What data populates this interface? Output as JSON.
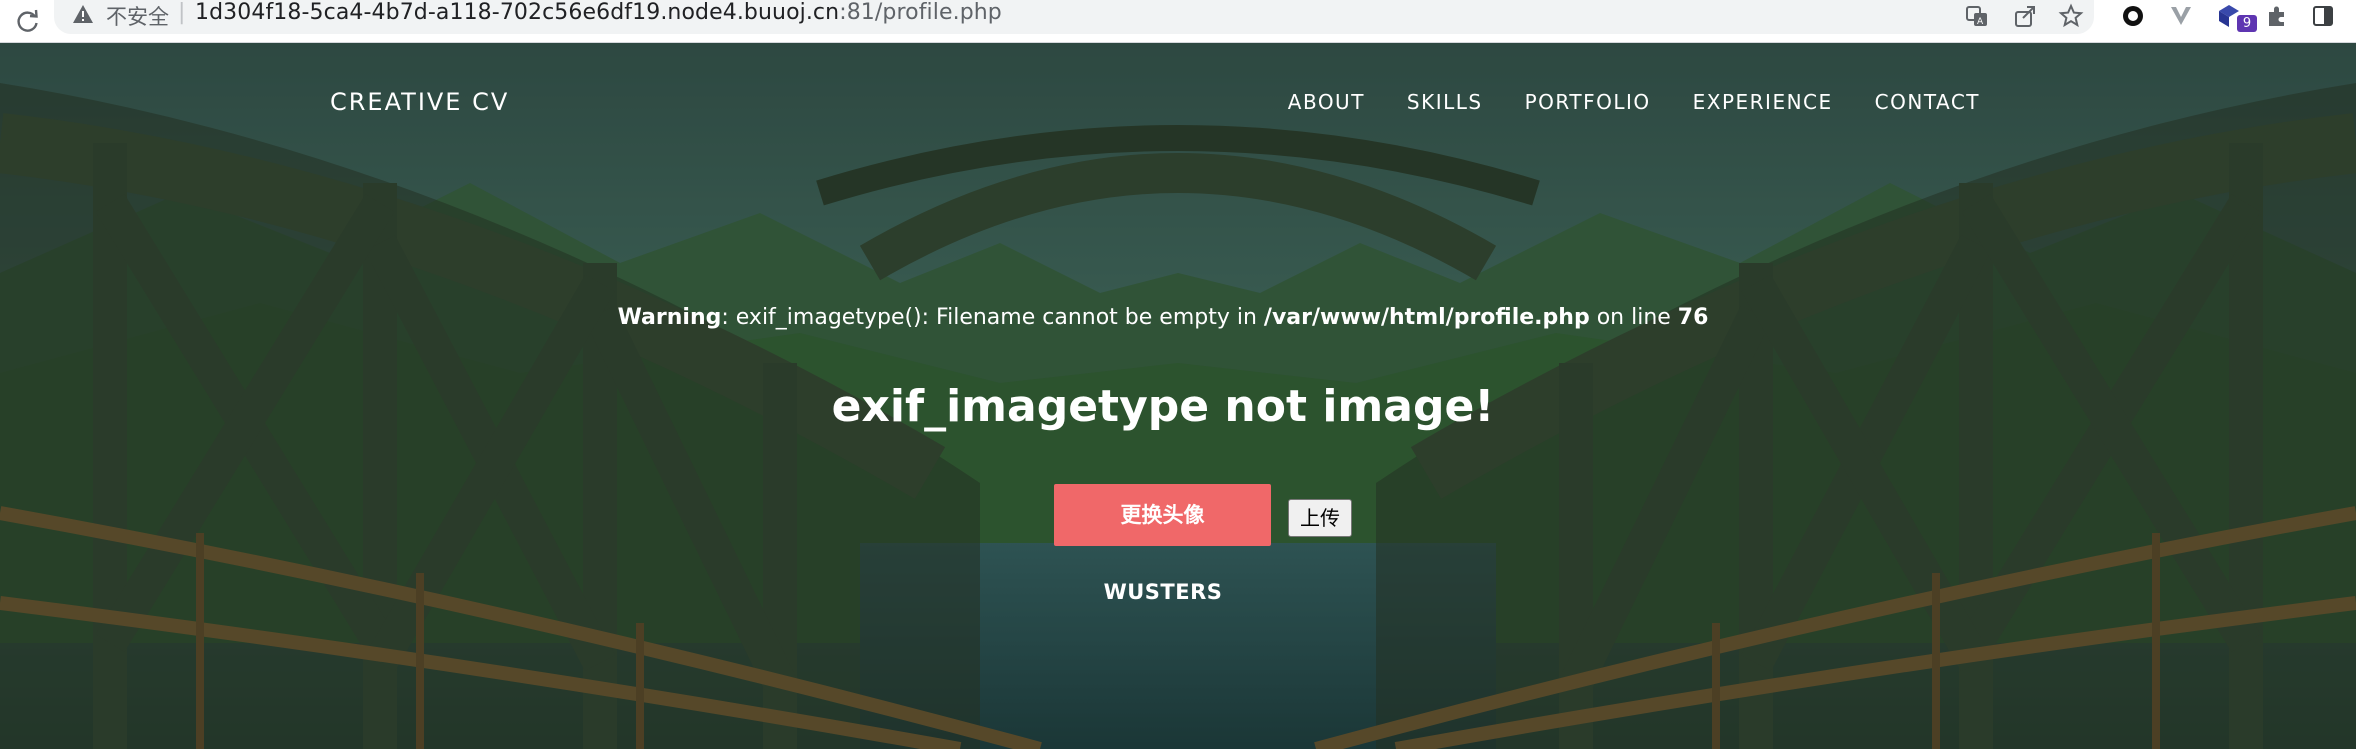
{
  "browser": {
    "security_label": "不安全",
    "separator": "|",
    "url_host": "1d304f18-5ca4-4b7d-a118-702c56e6df19.node4.buuoj.cn",
    "url_rest": ":81/profile.php",
    "extension_badge": "9"
  },
  "nav": {
    "brand": "CREATIVE CV",
    "links": [
      "ABOUT",
      "SKILLS",
      "PORTFOLIO",
      "EXPERIENCE",
      "CONTACT"
    ]
  },
  "warning": {
    "label": "Warning",
    "message": ": exif_imagetype(): Filename cannot be empty in ",
    "path": "/var/www/html/profile.php",
    "on_line": " on line ",
    "line_no": "76"
  },
  "result_title": "exif_imagetype not image!",
  "buttons": {
    "change_avatar": "更换头像",
    "upload": "上传"
  },
  "username": "WUSTERS",
  "colors": {
    "accent_button": "#f06869",
    "hero_overlay": "#2f4a3a"
  }
}
